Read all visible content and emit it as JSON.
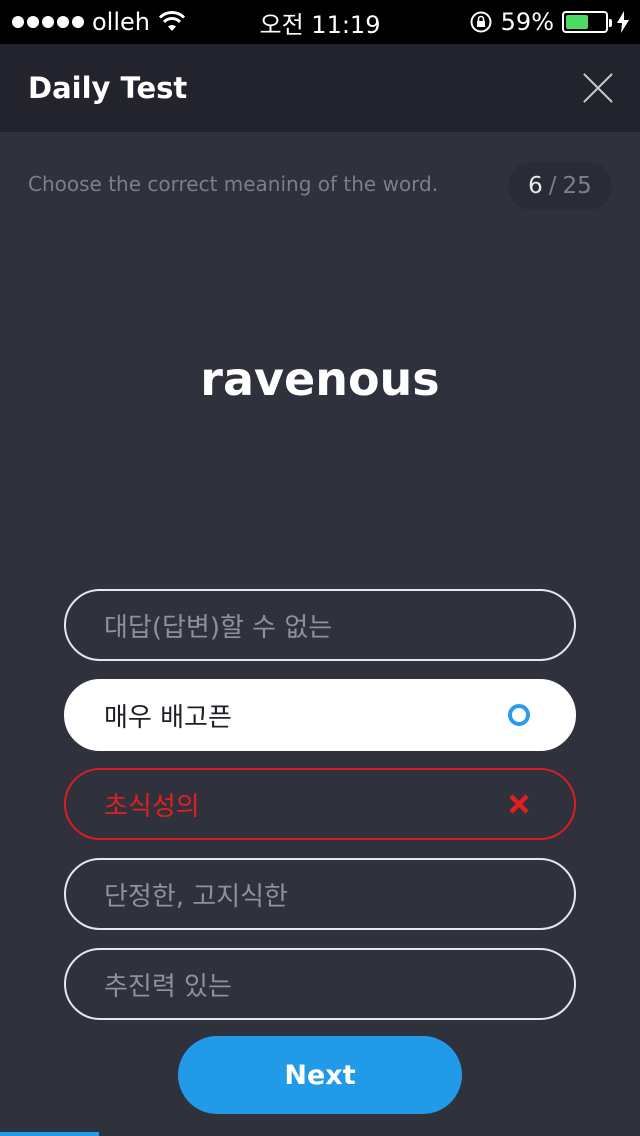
{
  "status_bar": {
    "carrier": "olleh",
    "time": "오전 11:19",
    "battery_percent": "59%",
    "battery_level": 0.59,
    "battery_color": "#4cd964"
  },
  "header": {
    "title": "Daily Test",
    "close_icon": "close-icon"
  },
  "instruction": "Choose the correct meaning of the word.",
  "counter": {
    "current": "6",
    "separator": "/",
    "total": "25"
  },
  "word": "ravenous",
  "options": [
    {
      "label": "대답(답변)할 수 없는",
      "state": "default"
    },
    {
      "label": "매우 배고픈",
      "state": "selected",
      "icon": "circle-icon"
    },
    {
      "label": "초식성의",
      "state": "wrong",
      "icon": "x-icon"
    },
    {
      "label": "단정한, 고지식한",
      "state": "default"
    },
    {
      "label": "추진력 있는",
      "state": "default"
    }
  ],
  "next_button": {
    "label": "Next"
  },
  "progress": {
    "fraction": 0.155
  },
  "colors": {
    "accent": "#219be8",
    "error": "#d81e1e",
    "background": "#2f313d",
    "header_bg": "#22232c"
  }
}
